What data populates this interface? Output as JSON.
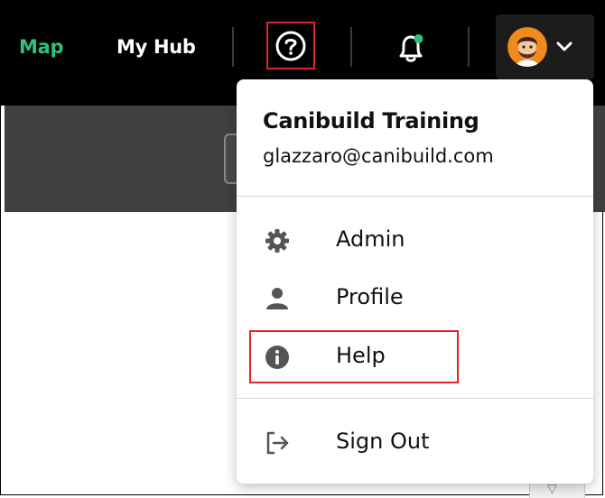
{
  "nav": {
    "map_label": "Map",
    "hub_label": "My Hub",
    "help_icon": "question-circle-icon",
    "bell_icon": "bell-icon",
    "notification_dot_color": "#2fbf7e"
  },
  "user_menu": {
    "avatar_icon": "avatar",
    "chevron_icon": "chevron-down-icon"
  },
  "dropdown": {
    "user_name": "Canibuild Training",
    "user_email": "glazzaro@canibuild.com",
    "items": [
      {
        "label": "Admin",
        "icon": "gear-icon"
      },
      {
        "label": "Profile",
        "icon": "person-icon"
      },
      {
        "label": "Help",
        "icon": "info-icon"
      },
      {
        "label": "Sign Out",
        "icon": "sign-out-icon"
      }
    ]
  },
  "colors": {
    "accent_green": "#2fbf7e",
    "highlight_red": "#e0242b",
    "topbar_bg": "#000000"
  }
}
